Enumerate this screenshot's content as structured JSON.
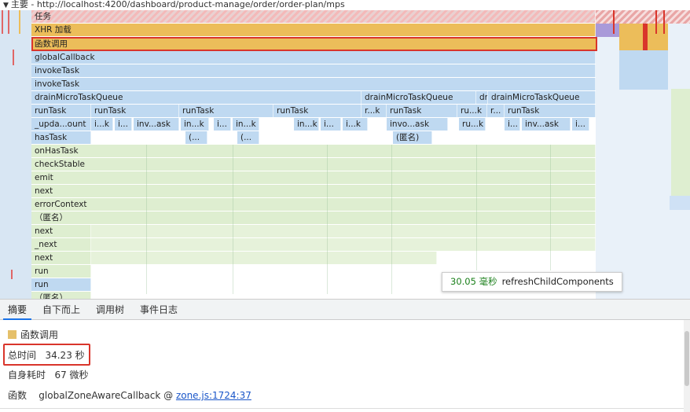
{
  "header": {
    "expand_icon": "triangle-down-icon",
    "label": "主要",
    "url": " - http://localhost:4200/dashboard/product-manage/order/order-plan/mps"
  },
  "flame": {
    "rows": {
      "task": "任务",
      "xhr": "XHR 加载",
      "function_call": "函数调用",
      "globalCallback": "globalCallback",
      "invokeTask1": "invokeTask",
      "invokeTask2": "invokeTask",
      "drainMicroTaskQueue": "drainMicroTaskQueue",
      "runTask": "runTask",
      "updateCount": "_upda...ount",
      "hasTask": "hasTask",
      "onHasTask": "onHasTask",
      "checkStable": "checkStable",
      "emit": "emit",
      "next1": "next",
      "errorContext": "errorContext",
      "anonymous1": "（匿名）",
      "next2": "next",
      "next_": "_next",
      "next3": "next",
      "run1": "run",
      "run2": "run",
      "anonymous2": "（匿名）"
    },
    "extra_labels": {
      "drain2": "drainMicroTaskQueue",
      "drain3": "dr...ue",
      "drain4": "drainMicroTaskQueue",
      "rt2": "runTask",
      "rt3": "runTask",
      "rt4": "runTask",
      "rt5": "r...k",
      "rt6": "runTask",
      "rt7": "ru...k",
      "rt8": "r...",
      "rt9": "runTask",
      "s1": "i...k",
      "s2": "i...",
      "s3": "inv...ask",
      "s4": "in...k",
      "s5": "i...",
      "s6": "in...k",
      "s7": "in...k",
      "s8": "i...",
      "s9": "i...k",
      "s10": "invo...ask",
      "s11": "ru...k",
      "s12": "i...",
      "s13": "inv...ask",
      "s14": "i...",
      "h1": "(...",
      "h2": "(...",
      "h3": "(匿名)"
    },
    "tooltip": {
      "duration": "30.05 毫秒",
      "name": "refreshChildComponents"
    }
  },
  "tabs": [
    "摘要",
    "自下而上",
    "调用树",
    "事件日志"
  ],
  "summary": {
    "title": "函数调用",
    "color": "#e5c06a",
    "total_label": "总时间",
    "total_value": "34.23 秒",
    "self_label": "自身耗时",
    "self_value": "67 微秒",
    "function_label": "函数",
    "function_name": "globalZoneAwareCallback @",
    "function_link": "zone.js:1724:37"
  }
}
